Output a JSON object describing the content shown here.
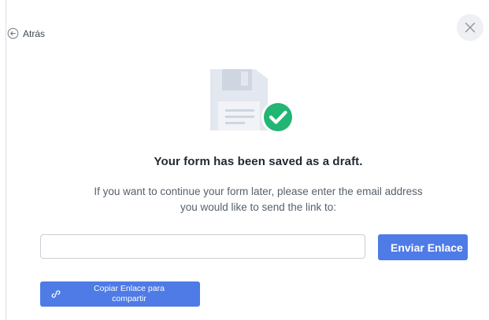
{
  "header": {
    "back_label": "Atrás",
    "back_icon": "arrow-left-circle-icon",
    "close_icon": "close-icon"
  },
  "illustration": {
    "icon": "floppy-disk-checkmark-icon",
    "colors": {
      "disk": "#e3e7ef",
      "disk_dark": "#cbd2de",
      "check_badge": "#22b573"
    }
  },
  "content": {
    "title": "Your form has been saved as a draft.",
    "message_line1": "If you want to continue your form later, please enter the email address",
    "message_line2": "you would like to send the link to:"
  },
  "email_input": {
    "value": "",
    "placeholder": ""
  },
  "actions": {
    "send_label": "Enviar Enlace",
    "copy_label_line1": "Copiar Enlace para",
    "copy_label_line2": "compartir",
    "copy_icon": "link-icon"
  },
  "colors": {
    "accent": "#4e7be6",
    "text_dark": "#1f2933",
    "text_muted": "#57606b"
  }
}
